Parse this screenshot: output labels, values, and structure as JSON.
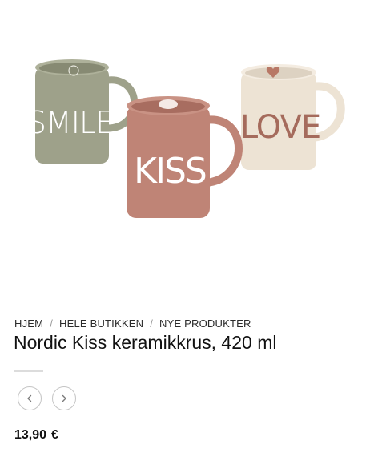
{
  "breadcrumb": {
    "items": [
      "HJEM",
      "HELE BUTIKKEN",
      "NYE PRODUKTER"
    ],
    "separator": "/"
  },
  "product": {
    "title": "Nordic Kiss keramikkrus, 420 ml",
    "price_amount": "13,90",
    "price_currency": "€",
    "image": {
      "mugs": [
        {
          "text": "SMILE",
          "color": "#9ea18a"
        },
        {
          "text": "KISS",
          "color": "#bf8476"
        },
        {
          "text": "LOVE",
          "color": "#ede3d4"
        }
      ]
    }
  },
  "gallery_nav": {
    "prev_icon": "chevron-left-icon",
    "next_icon": "chevron-right-icon"
  },
  "colors": {
    "text": "#111111",
    "divider": "#dcdcdc",
    "nav_border": "#c4c4c4"
  }
}
